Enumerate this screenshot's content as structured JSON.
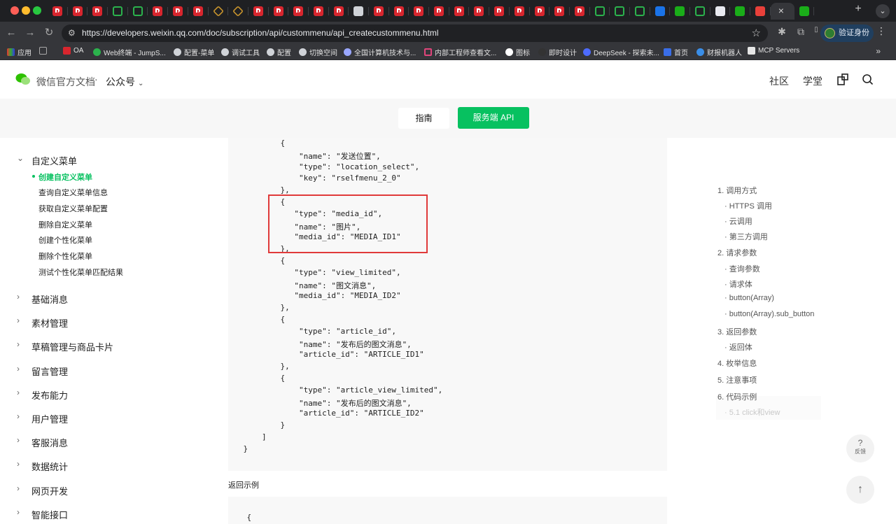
{
  "browser": {
    "tab_favicons": [
      "p",
      "p",
      "p",
      "g",
      "g",
      "p",
      "p",
      "p",
      "o",
      "o",
      "p",
      "p",
      "p",
      "p",
      "p",
      "c",
      "p",
      "p",
      "p",
      "p",
      "p",
      "p",
      "p",
      "p",
      "p",
      "p",
      "p",
      "g",
      "g",
      "g",
      "b",
      "w",
      "g",
      "n",
      "w",
      "r",
      "w"
    ],
    "active_tab_close": "×",
    "new_tab": "+",
    "url": "https://developers.weixin.qq.com/doc/subscription/api/custommenu/api_createcustommenu.html",
    "profile_label": "验证身份",
    "bookmarks": [
      "应用",
      "OA",
      "Web终端 - JumpS...",
      "配置-菜单",
      "调试工具",
      "配置",
      "切换空间",
      "全国计算机技术与...",
      "内部工程师查看文...",
      "图标",
      "即时设计",
      "DeepSeek - 探索未...",
      "首页",
      "财报机器人",
      "MCP Servers"
    ],
    "bookmarks_more": "»",
    "colors": {
      "tabbar": "#1f2023",
      "toolbar": "#35363a",
      "accent_green": "#07c160"
    }
  },
  "header": {
    "site_title": "微信官方文档",
    "dot": "·",
    "product": "公众号",
    "community": "社区",
    "academy": "学堂"
  },
  "subnav": {
    "guide": "指南",
    "server_api": "服务端 API"
  },
  "sidebar": {
    "expanded_group": "自定义菜单",
    "sub_items": [
      "创建自定义菜单",
      "查询自定义菜单信息",
      "获取自定义菜单配置",
      "删除自定义菜单",
      "创建个性化菜单",
      "删除个性化菜单",
      "测试个性化菜单匹配结果"
    ],
    "active_index": 0,
    "groups": [
      "基础消息",
      "素材管理",
      "草稿管理与商品卡片",
      "留言管理",
      "发布能力",
      "用户管理",
      "客服消息",
      "数据统计",
      "网页开发",
      "智能接口"
    ]
  },
  "code": {
    "lines": [
      "            {",
      "                \"name\": \"发送位置\",",
      "                \"type\": \"location_select\",",
      "                \"key\": \"rselfmenu_2_0\"",
      "            },",
      "            {",
      "               \"type\": \"media_id\",",
      "               \"name\": \"图片\",",
      "               \"media_id\": \"MEDIA_ID1\"",
      "            },",
      "            {",
      "               \"type\": \"view_limited\",",
      "               \"name\": \"图文消息\",",
      "               \"media_id\": \"MEDIA_ID2\"",
      "            },",
      "            {",
      "                \"type\": \"article_id\",",
      "                \"name\": \"发布后的图文消息\",",
      "                \"article_id\": \"ARTICLE_ID1\"",
      "            },",
      "            {",
      "                \"type\": \"article_view_limited\",",
      "                \"name\": \"发布后的图文消息\",",
      "                \"article_id\": \"ARTICLE_ID2\"",
      "            }",
      "        ]",
      "    }"
    ],
    "return_label": "返回示例",
    "return_first_line": "    {"
  },
  "toc": [
    {
      "text": "1. 调用方式",
      "level": 1
    },
    {
      "text": "· HTTPS 调用",
      "level": 2
    },
    {
      "text": "· 云调用",
      "level": 2
    },
    {
      "text": "· 第三方调用",
      "level": 2
    },
    {
      "text": "2. 请求参数",
      "level": 1
    },
    {
      "text": "· 查询参数",
      "level": 2
    },
    {
      "text": "· 请求体",
      "level": 2
    },
    {
      "text": "· button(Array)",
      "level": 2
    },
    {
      "text": "· button(Array).sub_button",
      "level": 2
    },
    {
      "text": "3. 返回参数",
      "level": 1
    },
    {
      "text": "· 返回体",
      "level": 2
    },
    {
      "text": "4. 枚举信息",
      "level": 1
    },
    {
      "text": "5. 注意事项",
      "level": 1
    },
    {
      "text": "6. 代码示例",
      "level": 1
    },
    {
      "text": "· 5.1 click和view",
      "level": 2
    }
  ],
  "float": {
    "feedback_icon": "?",
    "feedback_label": "反馈",
    "top_icon": "↑"
  }
}
